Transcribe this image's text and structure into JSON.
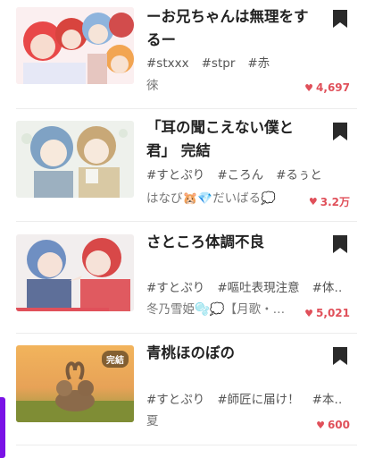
{
  "stories": [
    {
      "title": "ーお兄ちゃんは無理をするー",
      "tags": [
        "#stxxx",
        "#stpr",
        "#赤"
      ],
      "author": "徠",
      "likes": "4,697",
      "completed": false,
      "read_progress": 0
    },
    {
      "title": "「耳の聞こえない僕と君」 完結",
      "tags": [
        "#すとぷり",
        "#ころん",
        "#るぅと"
      ],
      "author": "はなび🐹💎だいばる💭",
      "likes": "3.2万",
      "completed": false,
      "read_progress": 0
    },
    {
      "title": "さところ体調不良",
      "tags": [
        "#すとぷり",
        "#嘔吐表現注意",
        "#体…"
      ],
      "author": "冬乃雪姫🫧💭【月歌・…",
      "likes": "5,021",
      "completed": false,
      "read_progress": 0.79
    },
    {
      "title": "青桃ほのぼの",
      "tags": [
        "#すとぷり",
        "#師匠に届け！",
        "#本…"
      ],
      "author": "夏",
      "likes": "600",
      "completed": true,
      "completed_label": "完結",
      "read_progress": 0
    }
  ],
  "colors": {
    "accent": "#e0505a",
    "scroll_indicator": "#7a12e6"
  },
  "icons": {
    "bookmark": "bookmark-icon",
    "like": "heart-icon"
  }
}
